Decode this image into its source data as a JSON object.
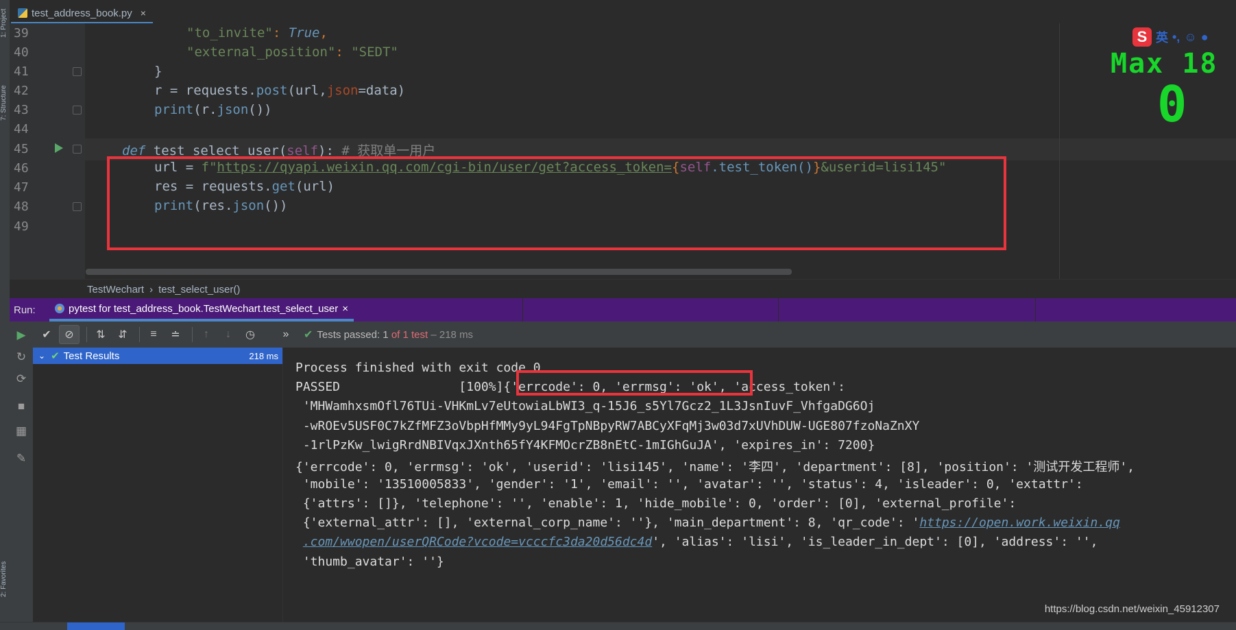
{
  "editor": {
    "tab_label": "test_address_book.py",
    "tab_close": "×",
    "line_numbers": [
      "39",
      "40",
      "41",
      "42",
      "43",
      "44",
      "45",
      "46",
      "47",
      "48",
      "49"
    ],
    "lines": {
      "l39_key": "\"to_invite\"",
      "l39_colon": ": ",
      "l39_val": "True",
      "l39_end": ",",
      "l40_key": "\"external_position\"",
      "l40_colon": ": ",
      "l40_val": "\"SEDT\"",
      "l41": "}",
      "l42_a": "r = requests.",
      "l42_post": "post",
      "l42_b": "(url,",
      "l42_param": "json",
      "l42_c": "=data)",
      "l43_print": "print",
      "l43_a": "(r.",
      "l43_json": "json",
      "l43_b": "())",
      "l45_def": "def",
      "l45_name": "test_select_user",
      "l45_open": "(",
      "l45_self": "self",
      "l45_close": "):",
      "l45_comment": "# 获取单一用户",
      "l46_a": "url = ",
      "l46_f": "f\"",
      "l46_url": "https://qyapi.weixin.qq.com/cgi-bin/user/get?access_token=",
      "l46_brace_open": "{",
      "l46_self": "self",
      "l46_mid": ".test_token()",
      "l46_brace_close": "}",
      "l46_tail": "&userid=lisi145\"",
      "l47_a": "res = requests.",
      "l47_get": "get",
      "l47_b": "(url)",
      "l48_print": "print",
      "l48_a": "(res.",
      "l48_json": "json",
      "l48_b": "())"
    }
  },
  "breadcrumb": {
    "class": "TestWechart",
    "sep": "›",
    "method": "test_select_user()"
  },
  "run_bar": {
    "label": "Run:",
    "tab": "pytest for test_address_book.TestWechart.test_select_user",
    "tab_close": "×"
  },
  "toolbar": {
    "more": "»",
    "tests_passed": "Tests passed:",
    "count": "1",
    "of": "of 1 test",
    "duration": "– 218 ms"
  },
  "tree": {
    "label": "Test Results",
    "ms": "218 ms"
  },
  "console": {
    "lines": [
      "Process finished with exit code 0",
      "PASSED                [100%]{'errcode': 0, 'errmsg': 'ok', 'access_token':",
      " 'MHWamhxsmOfl76TUi-VHKmLv7eUtowiaLbWI3_q-15J6_s5Yl7Gcz2_1L3JsnIuvF_VhfgaDG6Oj",
      " -wROEv5USF0C7kZfMFZ3oVbpHfMMy9yL94FgTpNBpyRW7ABCyXFqMj3w03d7xUVhDUW-UGE807fzoNaZnXY",
      " -1rlPzKw_lwigRrdNBIVqxJXnth65fY4KFMOcrZB8nEtC-1mIGhGuJA', 'expires_in': 7200}",
      "{'errcode': 0, 'errmsg': 'ok', 'userid': 'lisi145', 'name': '李四', 'department': [8], 'position': '测试开发工程师',",
      " 'mobile': '13510005833', 'gender': '1', 'email': '', 'avatar': '', 'status': 4, 'isleader': 0, 'extattr':",
      " {'attrs': []}, 'telephone': '', 'enable': 1, 'hide_mobile': 0, 'order': [0], 'external_profile':"
    ],
    "l9_a": " {'external_attr': [], 'external_corp_name': ''}, 'main_department': 8, 'qr_code': '",
    "l9_link": "https://open.work.weixin.qq",
    "l10_link": ".com/wwopen/userQRCode?vcode=vcccfc3da20d56dc4d",
    "l10_b": "', 'alias': 'lisi', 'is_leader_in_dept': [0], 'address': '',",
    "l11": " 'thumb_avatar': ''}"
  },
  "overlay": {
    "ime_logo": "S",
    "ime_lang": "英",
    "ime_punct": "•,",
    "max_label": "Max 18",
    "max_value": "0"
  },
  "watermark": "https://blog.csdn.net/weixin_45912307",
  "colors": {
    "accent": "#4a88c7",
    "run_bar": "#4b1a78",
    "highlight_box": "#e8343c",
    "pass_green": "#59a869"
  }
}
